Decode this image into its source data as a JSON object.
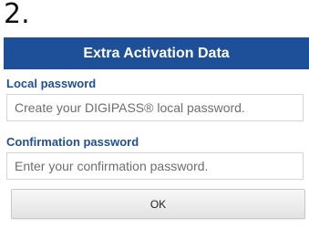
{
  "step": {
    "number": "2."
  },
  "dialog": {
    "title": "Extra Activation Data",
    "local_password": {
      "label": "Local password",
      "placeholder": "Create your DIGIPASS® local password.",
      "value": ""
    },
    "confirmation_password": {
      "label": "Confirmation password",
      "placeholder": "Enter your confirmation password.",
      "value": ""
    },
    "ok_button": {
      "label": "OK"
    }
  },
  "colors": {
    "title_bar": "#1e4f99",
    "label_text": "#1e4f99",
    "background": "#ffffff"
  }
}
